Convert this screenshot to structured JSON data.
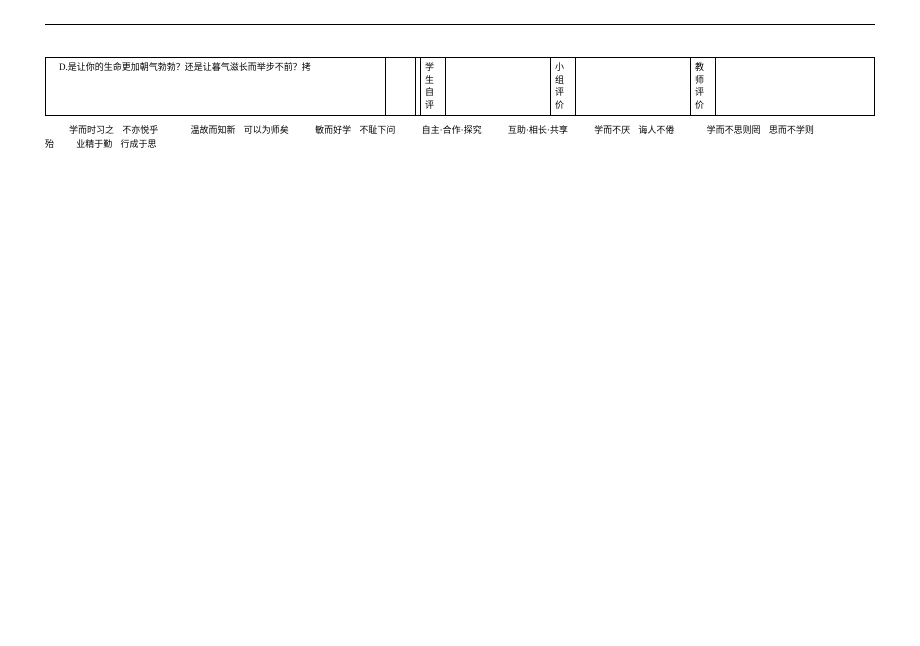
{
  "table": {
    "main_cell": "D.是让你的生命更加朝气勃勃？还是让暮气滋长而举步不前？拷",
    "col2": "",
    "col4": "学生自评",
    "col5": "",
    "col6": "小组评价",
    "col7": "",
    "col8": "教师评价",
    "col9": ""
  },
  "footer": {
    "line1": {
      "s1": "学而时习之",
      "s2": "不亦悦乎",
      "s3": "温故而知新",
      "s4": "可以为师矣",
      "s5": "敏而好学",
      "s6": "不耻下问",
      "s7": "自主·合作·探究",
      "s8": "互助·相长·共享",
      "s9": "学而不厌",
      "s10": "诲人不倦",
      "s11": "学而不思则罔",
      "s12": "思而不学则"
    },
    "line2": {
      "s1": "殆",
      "s2": "业精于勤",
      "s3": "行成于思"
    }
  }
}
